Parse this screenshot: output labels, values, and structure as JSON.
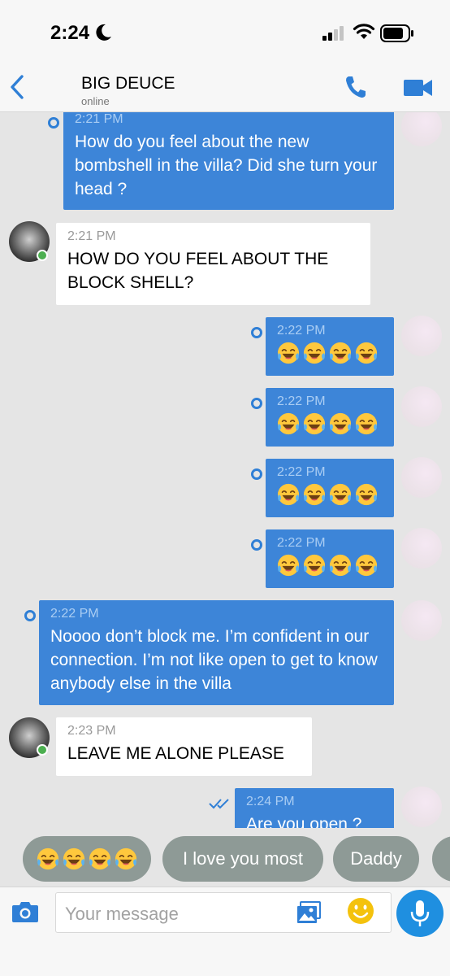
{
  "status_bar": {
    "time": "2:24"
  },
  "header": {
    "contact_name": "BIG DEUCE",
    "contact_status": "online"
  },
  "messages": [
    {
      "direction": "out",
      "time": "2:21 PM",
      "text": "How do you feel about the new bombshell in the villa? Did she turn your head ?"
    },
    {
      "direction": "in",
      "time": "2:21 PM",
      "text": "HOW DO YOU FEEL ABOUT THE BLOCK SHELL?"
    },
    {
      "direction": "out",
      "time": "2:22 PM",
      "emoji_count": 4
    },
    {
      "direction": "out",
      "time": "2:22 PM",
      "emoji_count": 4
    },
    {
      "direction": "out",
      "time": "2:22 PM",
      "emoji_count": 4
    },
    {
      "direction": "out",
      "time": "2:22 PM",
      "emoji_count": 4
    },
    {
      "direction": "out",
      "time": "2:22 PM",
      "text": "Noooo don’t block me. I’m confident in our connection. I’m not like open to get to know anybody else in the villa"
    },
    {
      "direction": "in",
      "time": "2:23 PM",
      "text": "LEAVE ME ALONE PLEASE"
    },
    {
      "direction": "out",
      "time": "2:24 PM",
      "text": "Are you open ?",
      "status": "read"
    }
  ],
  "quick_replies": [
    {
      "emoji_count": 4
    },
    {
      "label": "I love you most"
    },
    {
      "label": "Daddy"
    }
  ],
  "composer": {
    "placeholder": "Your message"
  },
  "colors": {
    "outgoing_bubble": "#3d85d8",
    "incoming_bubble": "#ffffff",
    "accent": "#1f8fe0",
    "chat_background": "#e5e5e5",
    "chip": "#8e9a96",
    "online": "#4caf50"
  },
  "icons": {
    "header": [
      "back-chevron-icon",
      "phone-icon",
      "video-camera-icon"
    ],
    "composer": [
      "camera-icon",
      "gallery-icon",
      "emoji-icon",
      "microphone-icon"
    ],
    "emoji": "face-with-tears-of-joy"
  }
}
